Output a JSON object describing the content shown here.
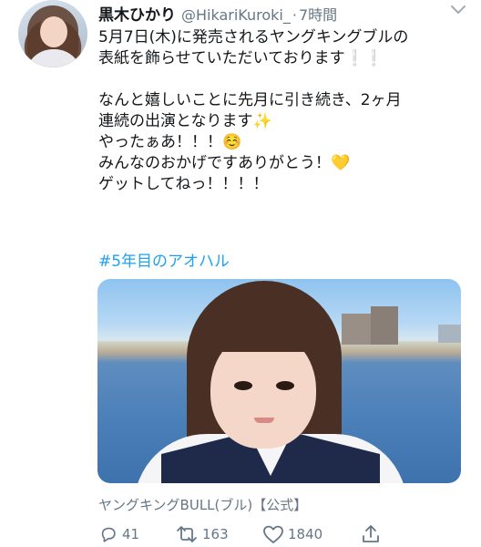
{
  "user": {
    "name": "黒木ひかり",
    "handle": "@HikariKuroki_",
    "separator": "·",
    "time": "7時間"
  },
  "tweet": {
    "lines": [
      "5月7日(木)に発売されるヤングキングブルの",
      "表紙を飾らせていただいております",
      "",
      "なんと嬉しいことに先月に引き続き、2ヶ月",
      "連続の出演となります",
      "やったぁあ！！！",
      "みんなのおかげですありがとう！",
      "ゲットしてねっ！！！！"
    ],
    "line2_suffix": "❕❕",
    "line5_emoji": "✨",
    "line6_emoji": "☺️",
    "line7_emoji": "💛",
    "hashtag": "#5年目のアオハル"
  },
  "media": {
    "alt": "photo"
  },
  "source": "ヤングキングBULL(ブル)【公式】",
  "actions": {
    "reply_count": "41",
    "retweet_count": "163",
    "like_count": "1840"
  },
  "colors": {
    "link": "#1da1f2",
    "muted": "#657786",
    "text": "#14171a"
  },
  "icons": [
    "chevron-down-icon",
    "reply-icon",
    "retweet-icon",
    "like-icon",
    "share-icon"
  ]
}
